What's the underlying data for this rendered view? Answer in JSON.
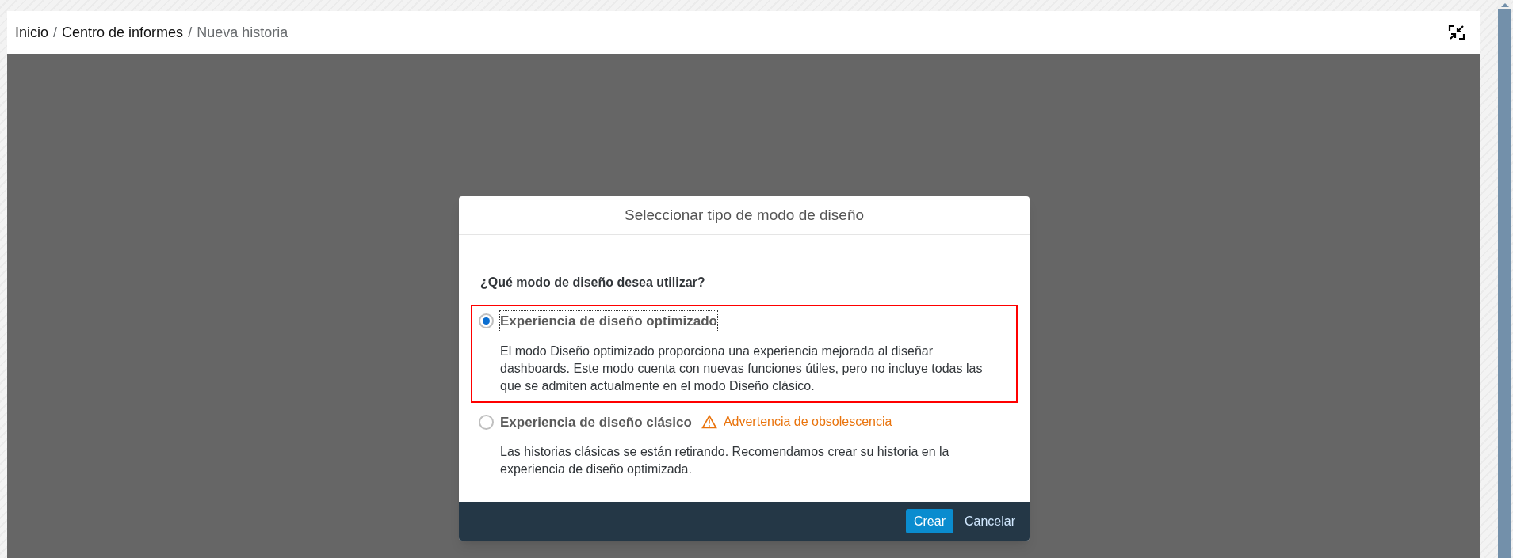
{
  "breadcrumb": [
    {
      "label": "Inicio",
      "current": false
    },
    {
      "separator": "/",
      "label": "Centro de informes",
      "current": false
    },
    {
      "separator": "/",
      "label": "Nueva historia",
      "current": true
    }
  ],
  "dialog": {
    "title": "Seleccionar tipo de modo de diseño",
    "question": "¿Qué modo de diseño desea utilizar?",
    "options": [
      {
        "label": "Experiencia de diseño optimizado",
        "selected": true,
        "highlighted": true,
        "description": "El modo Diseño optimizado proporciona una experiencia mejorada al diseñar dashboards. Este modo cuenta con nuevas funciones útiles, pero no incluye todas las que se admiten actualmente en el modo Diseño clásico."
      },
      {
        "label": "Experiencia de diseño clásico",
        "selected": false,
        "highlighted": false,
        "warning": "Advertencia de obsolescencia",
        "description": "Las historias clásicas se están retirando. Recomendamos crear su historia en la experiencia de diseño optimizada."
      }
    ],
    "buttons": [
      {
        "label": "Crear",
        "kind": "primary"
      },
      {
        "label": "Cancelar",
        "kind": "secondary"
      }
    ]
  }
}
